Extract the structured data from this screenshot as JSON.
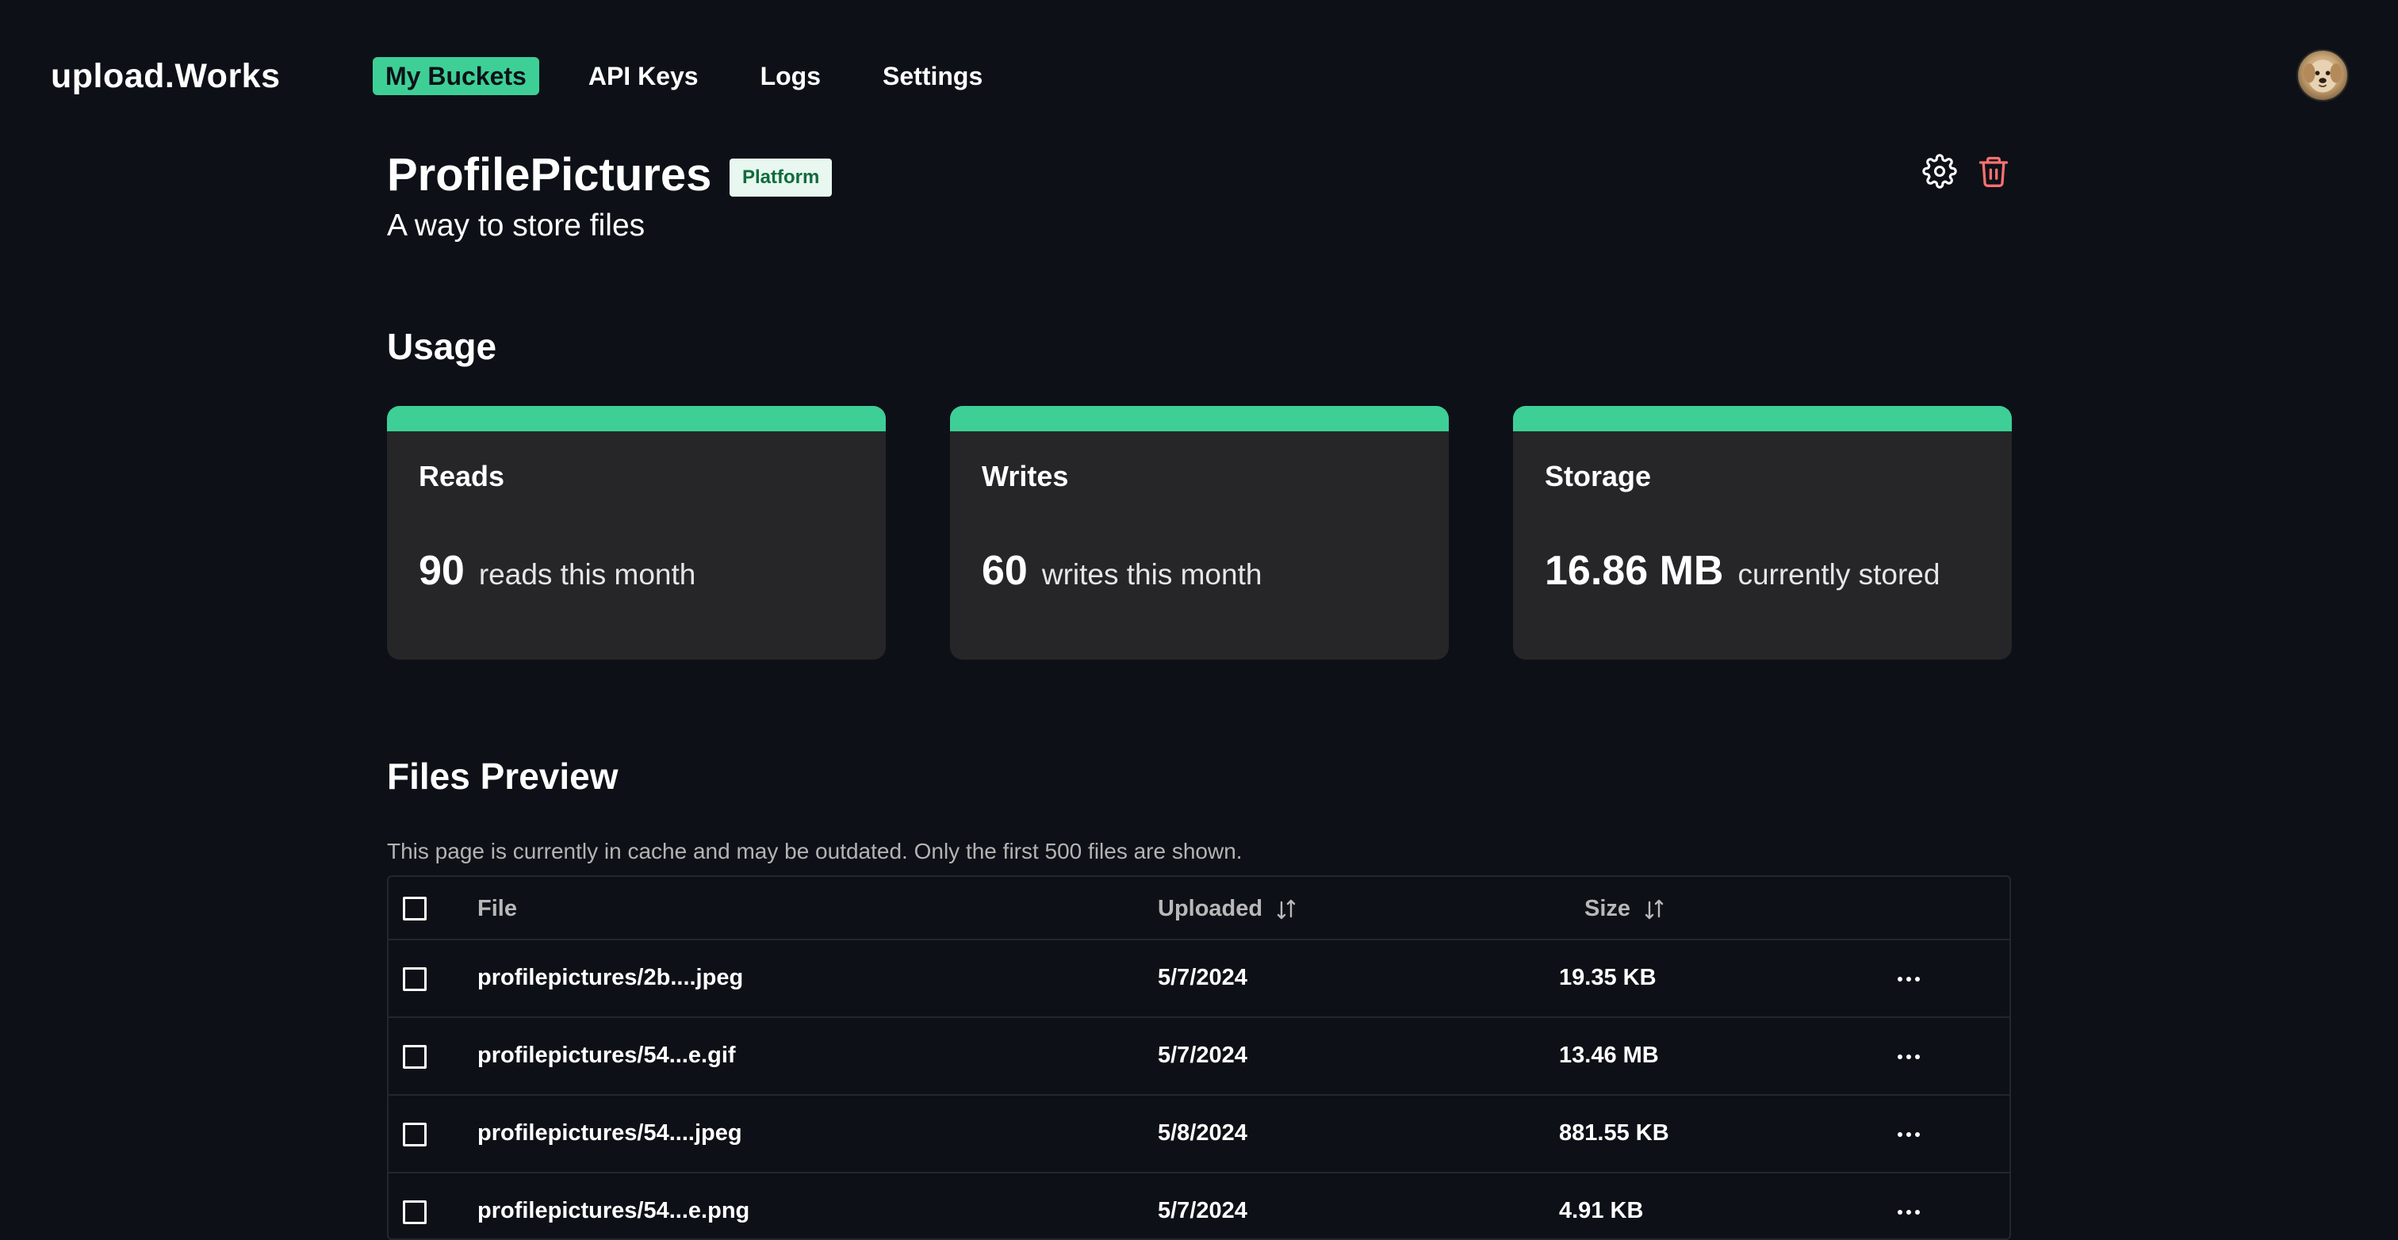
{
  "app": {
    "logo_text": "upload.Works",
    "accent_color": "#3ecf97",
    "background_color": "#0d1117"
  },
  "nav": {
    "items": [
      {
        "label": "My Buckets",
        "active": true
      },
      {
        "label": "API Keys",
        "active": false
      },
      {
        "label": "Logs",
        "active": false
      },
      {
        "label": "Settings",
        "active": false
      }
    ],
    "avatar_icon": "user-avatar-dog"
  },
  "bucket": {
    "name": "ProfilePictures",
    "badge": "Platform",
    "description": "A way to store files",
    "settings_icon": "gear-icon",
    "delete_icon": "trash-icon",
    "delete_color": "#f87171"
  },
  "usage": {
    "title": "Usage",
    "cards": [
      {
        "label": "Reads",
        "value": "90",
        "unit": "reads this month"
      },
      {
        "label": "Writes",
        "value": "60",
        "unit": "writes this month"
      },
      {
        "label": "Storage",
        "value": "16.86 MB",
        "unit": "currently stored"
      }
    ]
  },
  "files": {
    "title": "Files Preview",
    "note": "This page is currently in cache and may be outdated. Only the first 500 files are shown.",
    "columns": {
      "file": "File",
      "uploaded": "Uploaded",
      "size": "Size"
    },
    "rows": [
      {
        "file": "profilepictures/2b....jpeg",
        "uploaded": "5/7/2024",
        "size": "19.35 KB"
      },
      {
        "file": "profilepictures/54...e.gif",
        "uploaded": "5/7/2024",
        "size": "13.46 MB"
      },
      {
        "file": "profilepictures/54....jpeg",
        "uploaded": "5/8/2024",
        "size": "881.55 KB"
      },
      {
        "file": "profilepictures/54...e.png",
        "uploaded": "5/7/2024",
        "size": "4.91 KB"
      }
    ]
  }
}
